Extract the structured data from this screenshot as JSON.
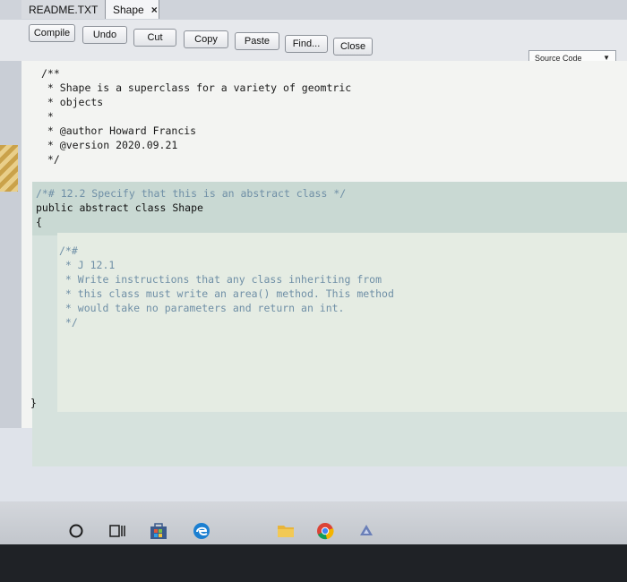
{
  "tabs": [
    {
      "label": "README.TXT",
      "close": "×"
    },
    {
      "label": "Shape",
      "close": "×"
    }
  ],
  "toolbar": {
    "buttons": [
      "Compile",
      "Undo",
      "Cut",
      "Copy",
      "Paste",
      "Find...",
      "Close"
    ],
    "view_select": "Source Code"
  },
  "code": {
    "header_comment": [
      "/**",
      " * Shape is a superclass for a variety of geomtric",
      " * objects",
      " *",
      " * @author Howard Francis",
      " * @version 2020.09.21",
      " */"
    ],
    "todo_comment": "/*# 12.2 Specify that this is an abstract class */",
    "class_decl": "public abstract class Shape",
    "open_brace": "{",
    "method_comment": [
      "/*#",
      " * J 12.1",
      " * Write instructions that any class inheriting from",
      " * this class must write an area() method. This method",
      " * would take no parameters and return an int.",
      " */"
    ],
    "close_brace": "}"
  },
  "taskbar": {
    "icons": [
      "search-circle-icon",
      "task-view-icon",
      "store-icon",
      "edge-icon",
      "folder-icon",
      "chrome-icon",
      "app-icon"
    ]
  }
}
